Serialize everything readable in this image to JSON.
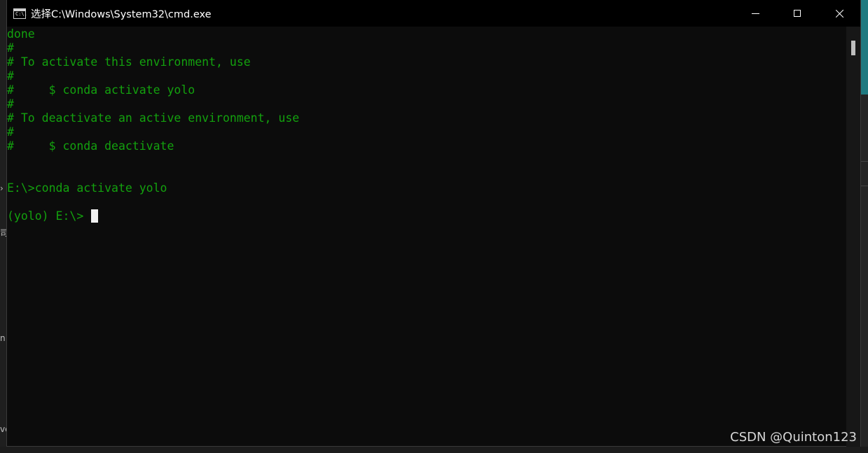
{
  "window": {
    "title": "选择C:\\Windows\\System32\\cmd.exe",
    "icon_text": "C:\\."
  },
  "controls": {
    "minimize": "minimize-icon",
    "maximize": "maximize-icon",
    "close": "close-icon"
  },
  "console": {
    "lines": [
      "done",
      "#",
      "# To activate this environment, use",
      "#",
      "#     $ conda activate yolo",
      "#",
      "# To deactivate an active environment, use",
      "#",
      "#     $ conda deactivate",
      "",
      "E:\\>conda activate yolo",
      "",
      "(yolo) E:\\>"
    ],
    "text_color": "#13a10e"
  },
  "watermark": "CSDN @Quinton123",
  "background": {
    "left_chars": [
      "›",
      "司",
      "n",
      "ve"
    ]
  }
}
